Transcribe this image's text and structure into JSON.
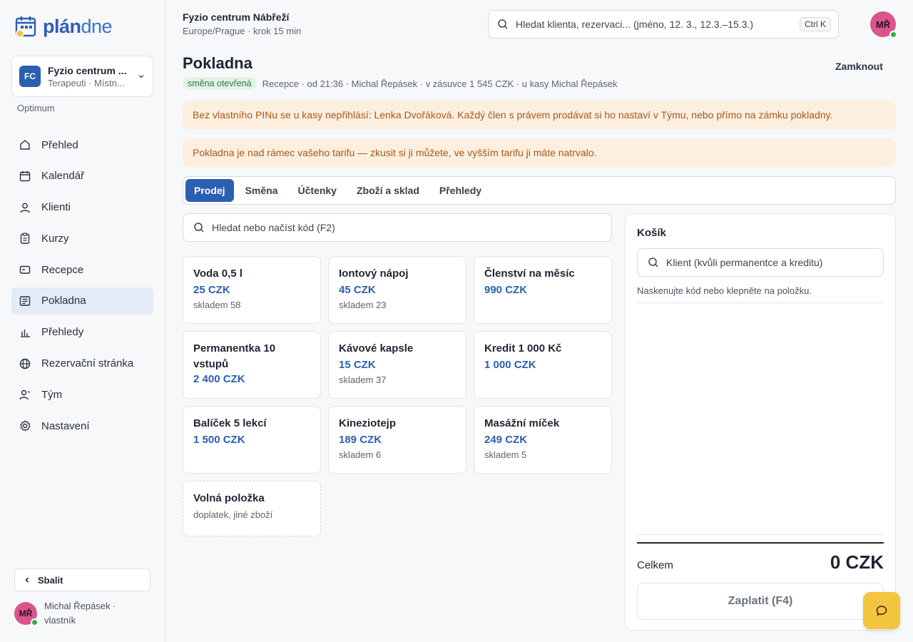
{
  "brand": {
    "logo_bold": "plán",
    "logo_light": "dne",
    "accent": "#2b5fb0"
  },
  "workspace": {
    "badge": "FC",
    "name": "Fyzio centrum ...",
    "sub": "Terapeuti · Místn...",
    "plan": "Optimum"
  },
  "nav": [
    {
      "label": "Přehled",
      "icon": "home-icon"
    },
    {
      "label": "Kalendář",
      "icon": "calendar-icon"
    },
    {
      "label": "Klienti",
      "icon": "user-icon"
    },
    {
      "label": "Kurzy",
      "icon": "clipboard-icon"
    },
    {
      "label": "Recepce",
      "icon": "card-icon"
    },
    {
      "label": "Pokladna",
      "icon": "register-icon",
      "active": true
    },
    {
      "label": "Přehledy",
      "icon": "bar-chart-icon"
    },
    {
      "label": "Rezervační stránka",
      "icon": "globe-icon"
    },
    {
      "label": "Tým",
      "icon": "team-icon"
    },
    {
      "label": "Nastavení",
      "icon": "gear-icon"
    }
  ],
  "sidebar_footer": {
    "collapse_label": "Sbalit",
    "user_initials": "MŘ",
    "user_line1": "Michal Řepásek ·",
    "user_line2": "vlastník"
  },
  "header": {
    "org_name": "Fyzio centrum Nábřeží",
    "org_sub": "Europe/Prague · krok 15 min",
    "search_placeholder": "Hledat klienta, rezervaci... (jméno, 12. 3., 12.3.–15.3.)",
    "search_shortcut": "Ctrl K",
    "avatar_initials": "MŘ"
  },
  "page": {
    "title": "Pokladna",
    "lock_label": "Zamknout",
    "status_badge": "směna otevřená",
    "status_text": "Recepce · od 21:36 · Michal Řepásek · v zásuvce 1 545 CZK · u kasy Michal Řepásek"
  },
  "alerts": [
    "Bez vlastního PINu se u kasy nepřihlásí: Lenka Dvořáková. Každý člen s právem prodávat si ho nastaví v Týmu, nebo přímo na zámku pokladny.",
    "Pokladna je nad rámec vašeho tarifu — zkusit si ji můžete, ve vyšším tarifu ji máte natrvalo."
  ],
  "tabs": [
    {
      "label": "Prodej",
      "active": true
    },
    {
      "label": "Směna"
    },
    {
      "label": "Účtenky"
    },
    {
      "label": "Zboží a sklad"
    },
    {
      "label": "Přehledy"
    }
  ],
  "product_search_placeholder": "Hledat nebo načíst kód (F2)",
  "products": [
    {
      "name": "Voda 0,5 l",
      "price": "25 CZK",
      "stock": "skladem 58"
    },
    {
      "name": "Iontový nápoj",
      "price": "45 CZK",
      "stock": "skladem 23"
    },
    {
      "name": "Členství na měsíc",
      "price": "990 CZK",
      "stock": ""
    },
    {
      "name": "Permanentka 10 vstupů",
      "price": "2 400 CZK",
      "stock": ""
    },
    {
      "name": "Kávové kapsle",
      "price": "15 CZK",
      "stock": "skladem 37"
    },
    {
      "name": "Kredit 1 000 Kč",
      "price": "1 000 CZK",
      "stock": ""
    },
    {
      "name": "Balíček 5 lekcí",
      "price": "1 500 CZK",
      "stock": ""
    },
    {
      "name": "Kineziotejp",
      "price": "189 CZK",
      "stock": "skladem 6"
    },
    {
      "name": "Masážní míček",
      "price": "249 CZK",
      "stock": "skladem 5"
    }
  ],
  "free_item": {
    "name": "Volná položka",
    "sub": "doplatek, jiné zboží"
  },
  "cart": {
    "title": "Košík",
    "client_placeholder": "Klient (kvůli permanentce a kreditu)",
    "hint": "Naskenujte kód nebo klepněte na položku.",
    "total_label": "Celkem",
    "total_value": "0 CZK",
    "pay_label": "Zaplatit (F4)"
  }
}
